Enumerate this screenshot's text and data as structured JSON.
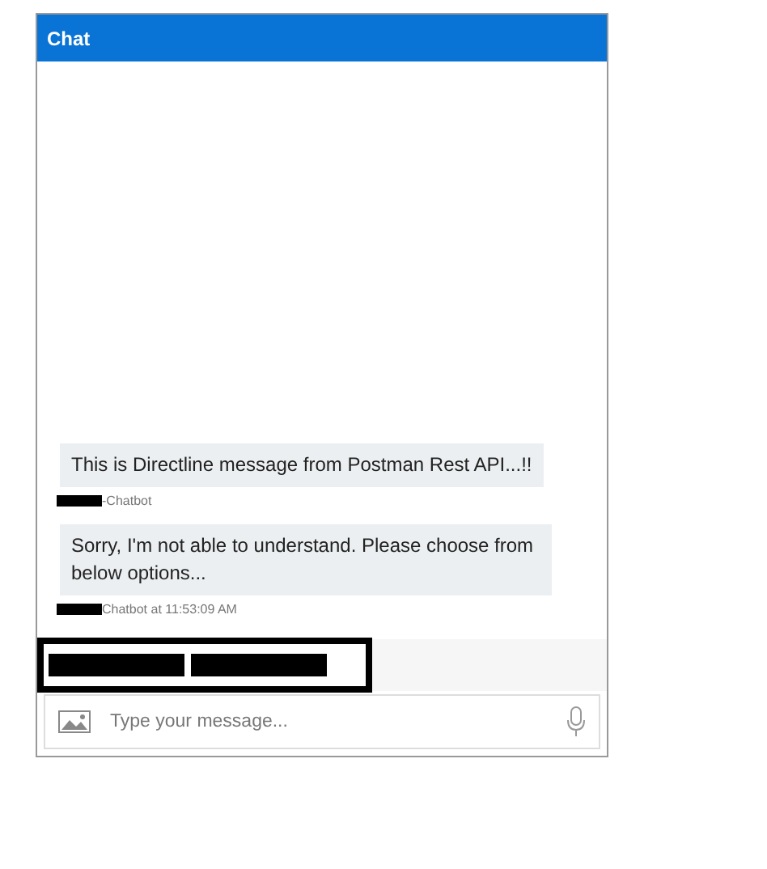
{
  "window": {
    "title": "Chat"
  },
  "messages": [
    {
      "text": "This is Directline message from Postman Rest API...!!",
      "meta": "-Chatbot"
    },
    {
      "text": "Sorry, I'm not able to understand. Please choose from below options...",
      "meta": "Chatbot at 11:53:09 AM"
    }
  ],
  "suggested_actions": [
    {
      "kind": "redacted"
    },
    {
      "kind": "redacted"
    }
  ],
  "input": {
    "placeholder": "Type your message..."
  }
}
